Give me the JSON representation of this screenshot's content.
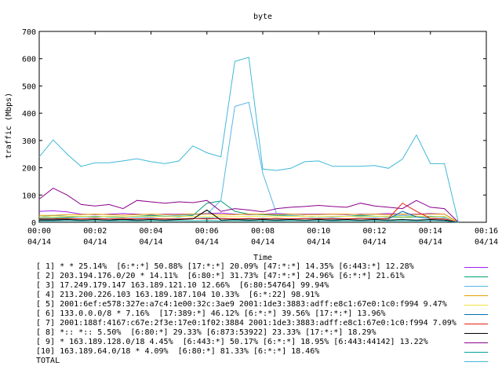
{
  "chart_data": {
    "type": "line",
    "title": "byte",
    "xlabel": "Time",
    "ylabel": "traffic (Mbps)",
    "ylim": [
      0,
      700
    ],
    "yticks": [
      "0",
      "100",
      "200",
      "300",
      "400",
      "500",
      "600",
      "700"
    ],
    "xticks": [
      {
        "time": "00:00",
        "date": "04/14"
      },
      {
        "time": "00:02",
        "date": "04/14"
      },
      {
        "time": "00:04",
        "date": "04/14"
      },
      {
        "time": "00:06",
        "date": "04/14"
      },
      {
        "time": "00:08",
        "date": "04/14"
      },
      {
        "time": "00:10",
        "date": "04/14"
      },
      {
        "time": "00:12",
        "date": "04/14"
      },
      {
        "time": "00:14",
        "date": "04/14"
      },
      {
        "time": "00:16",
        "date": "04/14"
      }
    ],
    "x": [
      "00:00",
      "00:00:30",
      "00:01",
      "00:01:30",
      "00:02",
      "00:02:30",
      "00:03",
      "00:03:30",
      "00:04",
      "00:04:30",
      "00:05",
      "00:05:30",
      "00:06",
      "00:06:30",
      "00:07",
      "00:07:30",
      "00:08",
      "00:08:30",
      "00:09",
      "00:09:30",
      "00:10",
      "00:10:30",
      "00:11",
      "00:11:30",
      "00:12",
      "00:12:30",
      "00:13",
      "00:13:30",
      "00:14",
      "00:14:30",
      "00:15"
    ],
    "series": [
      {
        "name": "[ 1] * * 25.14%  [6:*:*] 50.88% [17:*:*] 20.09% [47:*:*] 14.35% [6:443:*] 12.28%",
        "color": "#a020f0",
        "values": [
          40,
          42,
          38,
          30,
          28,
          30,
          32,
          30,
          28,
          30,
          30,
          30,
          32,
          34,
          30,
          28,
          30,
          32,
          30,
          30,
          30,
          30,
          28,
          30,
          30,
          32,
          30,
          30,
          32,
          30,
          0
        ]
      },
      {
        "name": "[ 2] 203.194.176.0/20 * 14.11%  [6:80:*] 31.73% [47:*:*] 24.96% [6:*:*] 21.61%",
        "color": "#009e73",
        "values": [
          15,
          15,
          18,
          20,
          22,
          20,
          18,
          22,
          25,
          22,
          20,
          25,
          70,
          78,
          40,
          30,
          28,
          25,
          25,
          22,
          20,
          20,
          22,
          25,
          22,
          20,
          18,
          20,
          22,
          20,
          0
        ]
      },
      {
        "name": "[ 3] 17.249.179.147 163.189.121.10 12.66%  [6:80:54764] 99.94%",
        "color": "#56b4e9",
        "values": [
          20,
          25,
          22,
          20,
          18,
          22,
          20,
          18,
          20,
          22,
          25,
          28,
          30,
          80,
          425,
          440,
          180,
          30,
          25,
          22,
          20,
          20,
          22,
          22,
          20,
          22,
          25,
          22,
          20,
          18,
          0
        ]
      },
      {
        "name": "[ 4] 213.200.226.103 163.189.187.104 10.33%  [6:*:22] 98.91%",
        "color": "#e69f00",
        "values": [
          25,
          25,
          28,
          28,
          30,
          28,
          26,
          28,
          30,
          28,
          28,
          30,
          30,
          28,
          28,
          30,
          30,
          28,
          30,
          28,
          28,
          30,
          30,
          28,
          30,
          28,
          30,
          28,
          30,
          30,
          0
        ]
      },
      {
        "name": "[ 5] 2001:6ef:e578:327e:a7c4:1e00:32c:3ae9 2001:1de3:3883:adff:e8c1:67e0:1c0:f994 9.47%",
        "color": "#f0e442",
        "values": [
          20,
          20,
          22,
          22,
          20,
          22,
          20,
          22,
          22,
          20,
          22,
          22,
          20,
          22,
          20,
          22,
          22,
          20,
          22,
          22,
          20,
          22,
          22,
          20,
          22,
          22,
          20,
          22,
          20,
          22,
          0
        ]
      },
      {
        "name": "[ 6] 133.0.0.0/8 * 7.16%  [17:389:*] 46.12% [6:*:*] 39.56% [17:*:*] 13.96%",
        "color": "#0072b2",
        "values": [
          10,
          10,
          12,
          12,
          14,
          12,
          10,
          12,
          14,
          12,
          12,
          14,
          15,
          14,
          12,
          12,
          14,
          12,
          12,
          14,
          14,
          12,
          12,
          14,
          14,
          12,
          40,
          20,
          14,
          12,
          0
        ]
      },
      {
        "name": "[ 7] 2001:188f:4167:c67e:2f3e:17e0:1f02:3884 2001:1de3:3883:adff:e8c1:67e0:1c0:f994 7.09%",
        "color": "#e51e10",
        "values": [
          12,
          12,
          14,
          12,
          14,
          12,
          14,
          12,
          14,
          12,
          12,
          14,
          12,
          14,
          12,
          14,
          12,
          14,
          12,
          14,
          12,
          14,
          12,
          14,
          12,
          14,
          70,
          40,
          14,
          12,
          0
        ]
      },
      {
        "name": "[ 8] *:: *:: 5.50%  [6:80:*] 29.33% [6:873:53922] 23.33% [17:*:*] 18.29%",
        "color": "#000000",
        "values": [
          8,
          8,
          10,
          8,
          10,
          8,
          10,
          8,
          10,
          8,
          10,
          12,
          45,
          8,
          10,
          8,
          10,
          8,
          10,
          8,
          10,
          8,
          10,
          8,
          10,
          8,
          10,
          8,
          10,
          8,
          0
        ]
      },
      {
        "name": "[ 9] * 163.189.128.0/18 4.45%  [6:443:*] 50.17% [6:*:*] 18.95% [6:443:44142] 13.22%",
        "color": "#8b008b",
        "values": [
          85,
          125,
          100,
          65,
          60,
          65,
          50,
          80,
          75,
          70,
          75,
          72,
          80,
          40,
          50,
          45,
          38,
          50,
          55,
          58,
          62,
          58,
          55,
          70,
          60,
          55,
          50,
          80,
          55,
          50,
          0
        ]
      },
      {
        "name": "[10] 163.189.64.0/18 * 4.09%  [6:80:*] 81.33% [6:*:*] 18.46%",
        "color": "#00a0a0",
        "values": [
          5,
          5,
          6,
          5,
          6,
          5,
          6,
          5,
          6,
          5,
          6,
          5,
          6,
          5,
          6,
          5,
          6,
          5,
          6,
          5,
          6,
          5,
          6,
          5,
          6,
          5,
          6,
          5,
          6,
          5,
          0
        ]
      },
      {
        "name": "TOTAL",
        "color": "#40b8d8",
        "values": [
          240,
          302,
          250,
          205,
          218,
          218,
          225,
          233,
          222,
          215,
          225,
          280,
          255,
          240,
          590,
          605,
          195,
          190,
          198,
          222,
          225,
          205,
          205,
          205,
          208,
          198,
          232,
          320,
          215,
          215,
          0
        ]
      }
    ]
  }
}
